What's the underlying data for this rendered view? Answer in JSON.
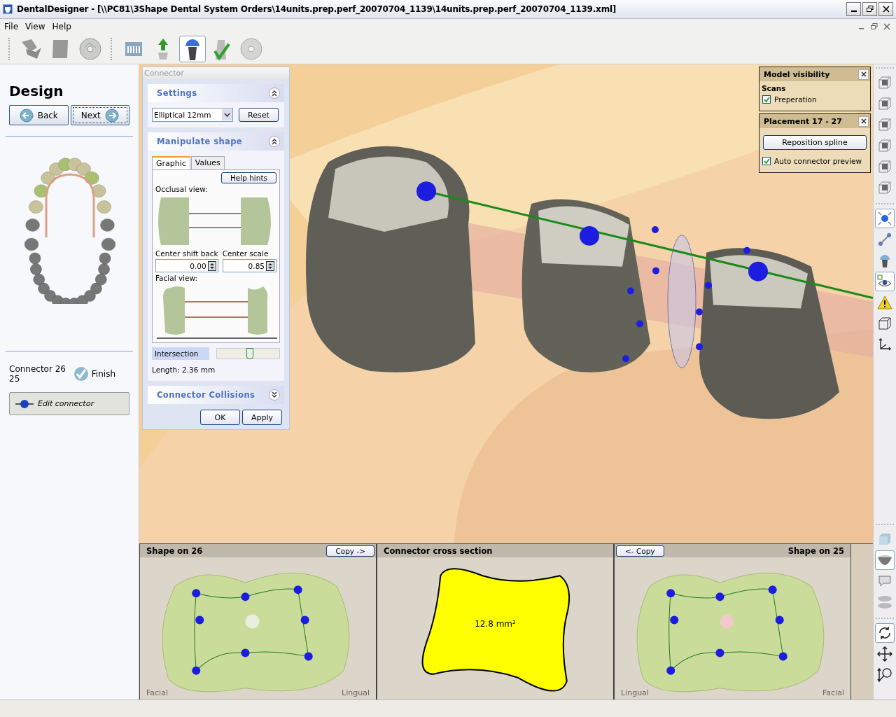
{
  "window": {
    "title": "DentalDesigner - [\\\\PC81\\3Shape Dental System Orders\\14units.prep.perf_20070704_1139\\14units.prep.perf_20070704_1139.xml]"
  },
  "menu": [
    {
      "label": "File"
    },
    {
      "label": "View"
    },
    {
      "label": "Help"
    }
  ],
  "toolbar": [
    {
      "kind": "stack",
      "selected": false
    },
    {
      "kind": "page",
      "selected": false
    },
    {
      "kind": "disc",
      "selected": false
    },
    {
      "kind": "grid",
      "selected": false
    },
    {
      "kind": "upload",
      "selected": false
    },
    {
      "kind": "crown",
      "selected": true
    },
    {
      "kind": "check",
      "selected": false
    },
    {
      "kind": "cd",
      "selected": false
    }
  ],
  "left": {
    "title": "Design",
    "back": "Back",
    "next": "Next",
    "connector": "Connector 26 25",
    "finish": "Finish",
    "edit": "Edit connector"
  },
  "connector_panel": {
    "title": "Connector",
    "settings": {
      "title": "Settings",
      "expanded": true,
      "dropdown": "Elliptical 12mm",
      "reset": "Reset"
    },
    "manipulate": {
      "title": "Manipulate shape",
      "expanded": true,
      "tabs": [
        {
          "label": "Graphic",
          "selected": true
        },
        {
          "label": "Values",
          "selected": false
        }
      ],
      "help": "Help hints",
      "occlusal": "Occlusal view:",
      "shift_label": "Center shift back",
      "shift_value": "0.00",
      "scale_label": "Center scale",
      "scale_value": "0.85",
      "facial": "Facial view:",
      "intersection": "Intersection",
      "level": 0.52,
      "length": "Length: 2.36 mm"
    },
    "collisions": {
      "title": "Connector Collisions",
      "expanded": false
    },
    "ok": "OK",
    "apply": "Apply"
  },
  "model_visibility": {
    "title": "Model visibility",
    "group": "Scans",
    "items": [
      {
        "label": "Preperation",
        "checked": true
      }
    ]
  },
  "placement": {
    "title": "Placement 17 - 27",
    "button": "Reposition spline",
    "items": [
      {
        "label": "Auto connector preview",
        "checked": true
      }
    ]
  },
  "bottom_panels": [
    {
      "kind": "shape",
      "header": [
        {
          "kind": "title",
          "text": "Shape on 26"
        },
        {
          "kind": "button",
          "text": "Copy ->"
        }
      ],
      "left_label": "Facial",
      "right_label": "Lingual"
    },
    {
      "kind": "section",
      "header": [
        {
          "kind": "title",
          "text": "Connector cross section"
        }
      ],
      "area": "12.8 mm²"
    },
    {
      "kind": "shape",
      "header": [
        {
          "kind": "button",
          "text": "<- Copy"
        },
        {
          "kind": "title",
          "text": "Shape on 25"
        }
      ],
      "left_label": "Lingual",
      "right_label": "Facial"
    }
  ],
  "right_toolbar": [
    [
      {
        "kind": "cube",
        "selected": false
      },
      {
        "kind": "cube",
        "selected": false
      },
      {
        "kind": "cube",
        "selected": false
      },
      {
        "kind": "cube",
        "selected": false
      },
      {
        "kind": "cube",
        "selected": false
      },
      {
        "kind": "cube",
        "selected": false
      }
    ],
    [
      {
        "kind": "zoom-fit",
        "selected": true
      },
      {
        "kind": "spline",
        "selected": false
      },
      {
        "kind": "crown",
        "selected": false
      },
      {
        "kind": "eye",
        "selected": true
      },
      {
        "kind": "warning",
        "selected": false
      },
      {
        "kind": "wire-cube",
        "selected": false
      },
      {
        "kind": "axes",
        "selected": false
      }
    ],
    [
      {
        "kind": "block",
        "selected": false
      },
      {
        "kind": "bowl",
        "selected": true
      },
      {
        "kind": "comment",
        "selected": false
      },
      {
        "kind": "disk",
        "selected": false
      }
    ],
    [
      {
        "kind": "rotate",
        "selected": true
      },
      {
        "kind": "pan",
        "selected": false
      },
      {
        "kind": "zoom",
        "selected": false
      }
    ]
  ]
}
